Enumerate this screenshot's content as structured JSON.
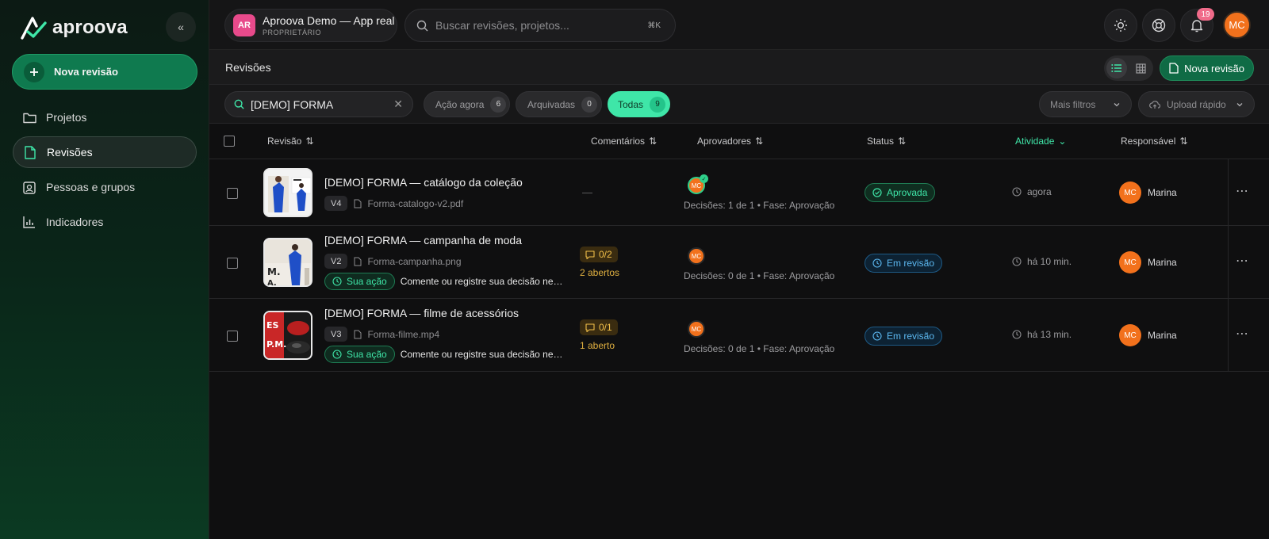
{
  "brand": {
    "name": "aproova"
  },
  "sidebar": {
    "new_review": "Nova revisão",
    "items": [
      {
        "label": "Projetos",
        "icon": "folder-icon"
      },
      {
        "label": "Revisões",
        "icon": "file-icon",
        "active": true
      },
      {
        "label": "Pessoas e grupos",
        "icon": "contacts-icon"
      },
      {
        "label": "Indicadores",
        "icon": "bar-chart-icon"
      }
    ]
  },
  "topbar": {
    "workspace": {
      "badge": "AR",
      "title": "Aproova Demo — App real",
      "role": "PROPRIETÁRIO"
    },
    "search_placeholder": "Buscar revisões, projetos...",
    "search_shortcut": "⌘K",
    "notifications": "19",
    "user_initials": "MC"
  },
  "subheader": {
    "title": "Revisões",
    "new_review": "Nova revisão"
  },
  "filters": {
    "search_value": "[DEMO] FORMA",
    "tabs": [
      {
        "label": "Ação agora",
        "count": "6"
      },
      {
        "label": "Arquivadas",
        "count": "0"
      },
      {
        "label": "Todas",
        "count": "9",
        "active": true
      }
    ],
    "more_filters": "Mais filtros",
    "quick_upload": "Upload rápido"
  },
  "table": {
    "headers": {
      "revision": "Revisão",
      "comments": "Comentários",
      "approvers": "Aprovadores",
      "status": "Status",
      "activity": "Atividade",
      "owner": "Responsável"
    },
    "rows": [
      {
        "title": "[DEMO] FORMA — catálogo da coleção",
        "version": "V4",
        "file": "Forma-catalogo-v2.pdf",
        "comments": "—",
        "approver_initials": "MC",
        "approvals": "Decisões: 1 de 1 • Fase: Aprovação",
        "status": "Aprovada",
        "activity": "agora",
        "owner_initials": "MC",
        "owner": "Marina"
      },
      {
        "title": "[DEMO] FORMA — campanha de moda",
        "version": "V2",
        "file": "Forma-campanha.png",
        "action_label": "Sua ação",
        "action_text": "Comente ou registre sua decisão nesta revisão",
        "comments_badge": "0/2",
        "comments_open": "2 abertos",
        "approver_initials": "MC",
        "approvals": "Decisões: 0 de 1 • Fase: Aprovação",
        "status": "Em revisão",
        "activity": "há 10 min.",
        "owner_initials": "MC",
        "owner": "Marina"
      },
      {
        "title": "[DEMO] FORMA — filme de acessórios",
        "version": "V3",
        "file": "Forma-filme.mp4",
        "action_label": "Sua ação",
        "action_text": "Comente ou registre sua decisão nesta revisão",
        "comments_badge": "0/1",
        "comments_open": "1 aberto",
        "approver_initials": "MC",
        "approvals": "Decisões: 0 de 1 • Fase: Aprovação",
        "status": "Em revisão",
        "activity": "há 13 min.",
        "owner_initials": "MC",
        "owner": "Marina"
      }
    ]
  }
}
